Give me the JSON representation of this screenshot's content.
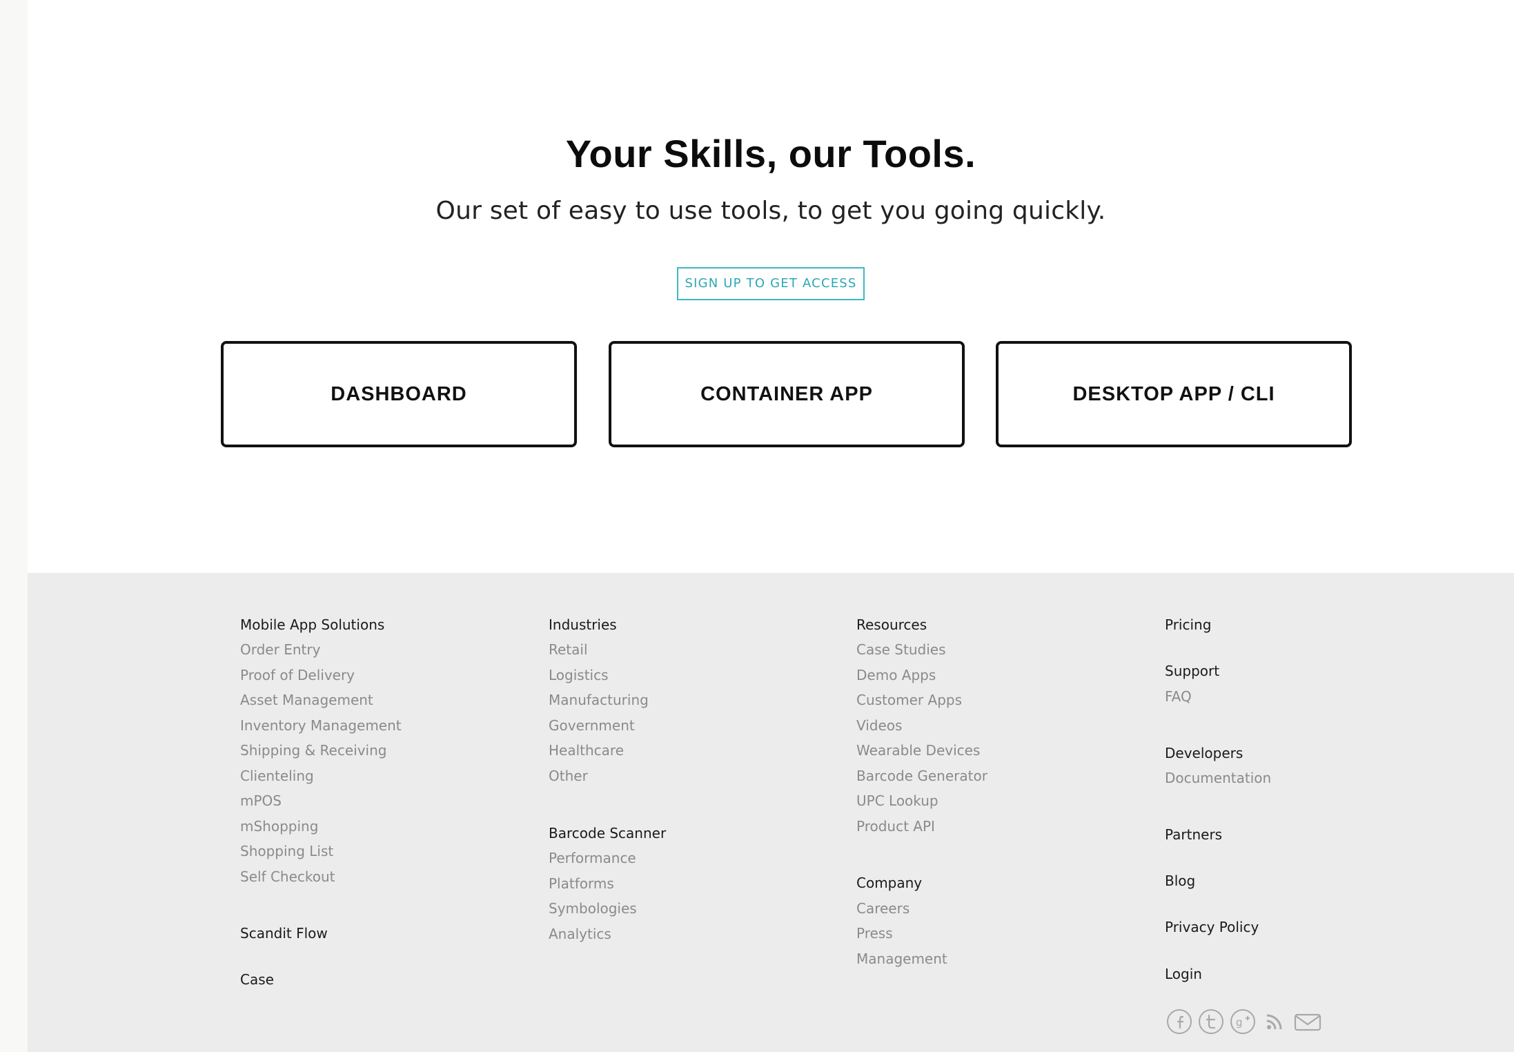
{
  "hero": {
    "title": "Your Skills, our Tools.",
    "subtitle": "Our set of easy to use tools, to get you going quickly.",
    "cta_label": "SIGN UP TO GET ACCESS"
  },
  "tools": [
    {
      "label": "DASHBOARD"
    },
    {
      "label": "CONTAINER APP"
    },
    {
      "label": "DESKTOP APP / CLI"
    }
  ],
  "footer": {
    "col1": {
      "solutions_head": "Mobile App Solutions",
      "solutions": [
        "Order Entry",
        "Proof of Delivery",
        "Asset Management",
        "Inventory Management",
        "Shipping & Receiving",
        "Clienteling",
        "mPOS",
        "mShopping",
        "Shopping List",
        "Self Checkout"
      ],
      "flow": "Scandit Flow",
      "case": "Case"
    },
    "col2": {
      "industries_head": "Industries",
      "industries": [
        "Retail",
        "Logistics",
        "Manufacturing",
        "Government",
        "Healthcare",
        "Other"
      ],
      "scanner_head": "Barcode Scanner",
      "scanner": [
        "Performance",
        "Platforms",
        "Symbologies",
        "Analytics"
      ]
    },
    "col3": {
      "resources_head": "Resources",
      "resources": [
        "Case Studies",
        "Demo Apps",
        "Customer Apps",
        "Videos",
        "Wearable Devices",
        "Barcode Generator",
        "UPC Lookup",
        "Product API"
      ],
      "company_head": "Company",
      "company": [
        "Careers",
        "Press",
        "Management"
      ]
    },
    "col4": {
      "pricing": "Pricing",
      "support": "Support",
      "faq": "FAQ",
      "developers": "Developers",
      "documentation": "Documentation",
      "partners": "Partners",
      "blog": "Blog",
      "privacy": "Privacy Policy",
      "login": "Login"
    },
    "social_icons": [
      "facebook-icon",
      "twitter-icon",
      "google-plus-icon",
      "rss-icon",
      "mail-icon"
    ]
  },
  "colors": {
    "accent": "#3fb8c4",
    "footer_bg": "#ececec",
    "heading_text": "#1a1a1a",
    "link_text": "#8a8a8a"
  }
}
